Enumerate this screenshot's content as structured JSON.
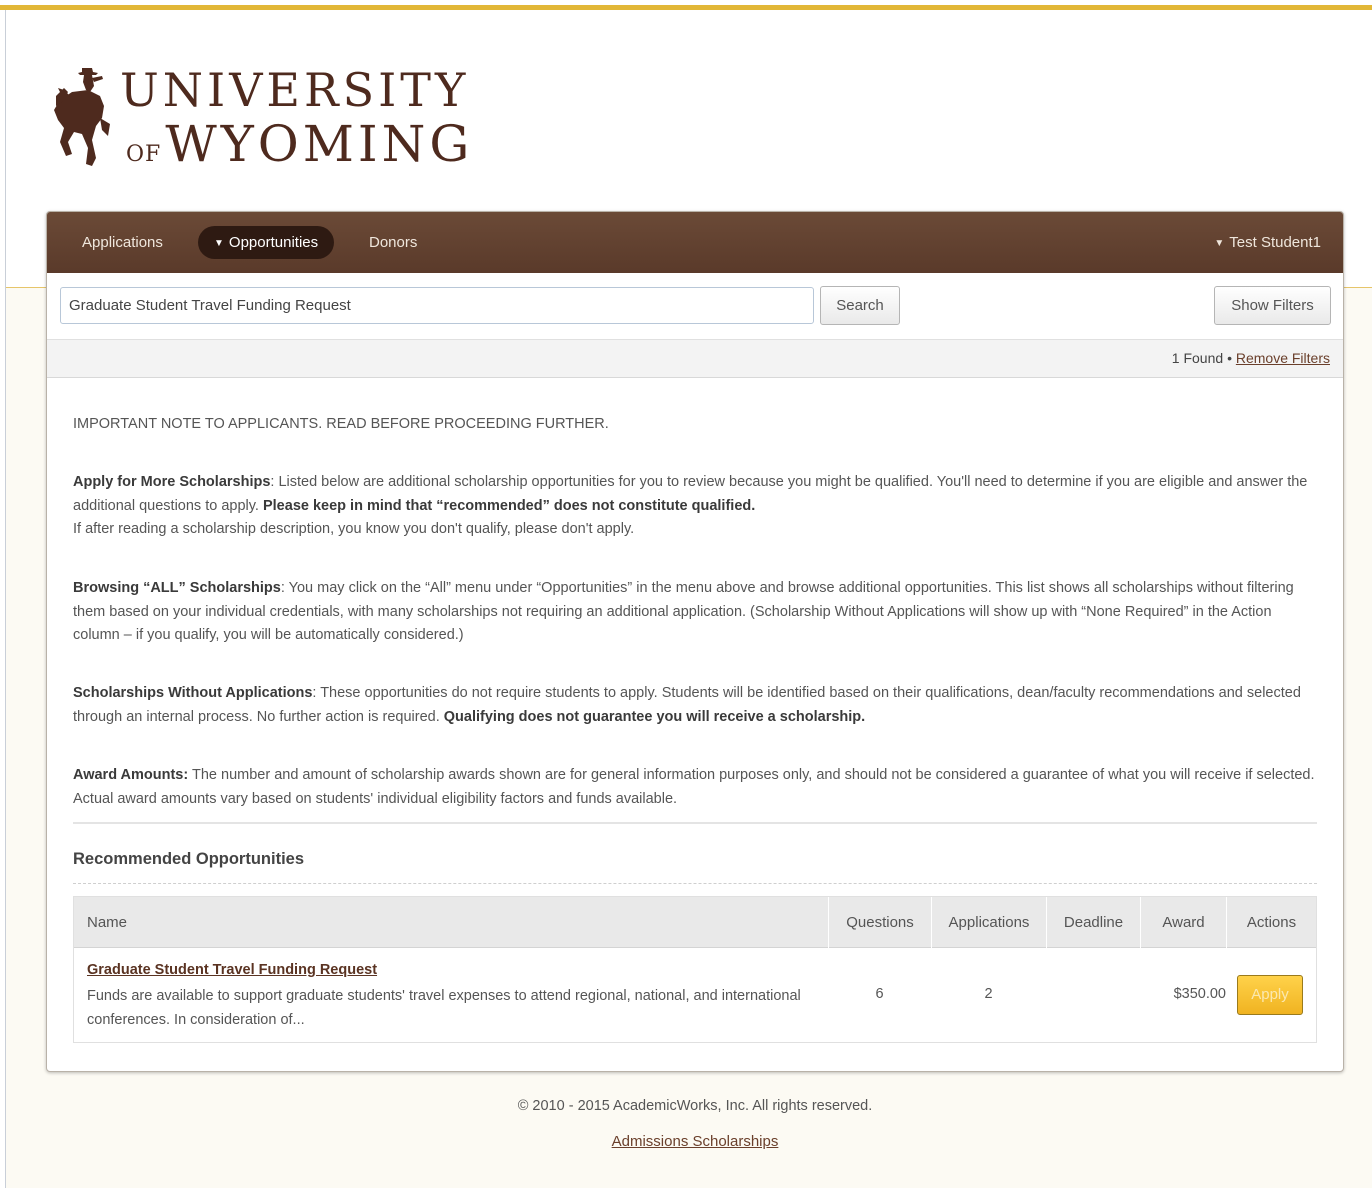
{
  "brand": {
    "line1": "UNIVERSITY",
    "of": "OF",
    "line2": "WYOMING",
    "logo_icon": "bucking-horse-rider-icon",
    "colors": {
      "brown": "#5a3a2a",
      "gold": "#e2b737"
    }
  },
  "nav": {
    "items": [
      {
        "label": "Applications"
      },
      {
        "label": "Opportunities",
        "active": true
      },
      {
        "label": "Donors"
      }
    ],
    "user": "Test Student1"
  },
  "search": {
    "value": "Graduate Student Travel Funding Request",
    "button": "Search",
    "filters_button": "Show Filters"
  },
  "results": {
    "count": "1 Found",
    "separator": "•",
    "remove_filters": "Remove Filters"
  },
  "notes": {
    "heading": "IMPORTANT NOTE TO APPLICANTS. READ BEFORE PROCEEDING FURTHER.",
    "apply_more_title": "Apply for More Scholarships",
    "apply_more_text": ": Listed below are additional scholarship opportunities for you to review because you might be qualified. You'll need to determine if you are eligible and answer the additional questions to apply.",
    "apply_more_bold": "Please keep in mind that “recommended” does not constitute qualified.",
    "apply_more_text2": "If after reading a scholarship description, you know you don't qualify, please don't apply.",
    "browsing_title": "Browsing “ALL” Scholarships",
    "browsing_text": ": You may click on the “All” menu under “Opportunities” in the menu above and browse additional opportunities. This list shows all scholarships without filtering them based on your individual credentials, with many scholarships not requiring an additional application. (Scholarship Without Applications will show up with “None Required” in the Action column – if you qualify, you will be automatically considered.)",
    "without_title": "Scholarships Without Applications",
    "without_text": ": These opportunities do not require students to apply. Students will be identified based on their qualifications, dean/faculty recommendations and selected through an internal process. No further action is required.",
    "without_bold": "Qualifying does not guarantee you will receive a scholarship.",
    "award_title": "Award Amounts:",
    "award_text": "The number and amount of scholarship awards shown are for general information purposes only, and should not be considered a guarantee of what you will receive if selected. Actual award amounts vary based on students' individual eligibility factors and funds available."
  },
  "recommended": {
    "title": "Recommended Opportunities",
    "columns": [
      "Name",
      "Questions",
      "Applications",
      "Deadline",
      "Award",
      "Actions"
    ],
    "rows": [
      {
        "name": "Graduate Student Travel Funding Request",
        "description": "Funds are available to support graduate students' travel expenses to attend regional, national, and international conferences. In consideration of...",
        "questions": "6",
        "applications": "2",
        "deadline": "",
        "award": "$350.00",
        "action": "Apply"
      }
    ]
  },
  "footer": {
    "copyright": "© 2010 - 2015 AcademicWorks, Inc. All rights reserved.",
    "link": "Admissions Scholarships"
  }
}
